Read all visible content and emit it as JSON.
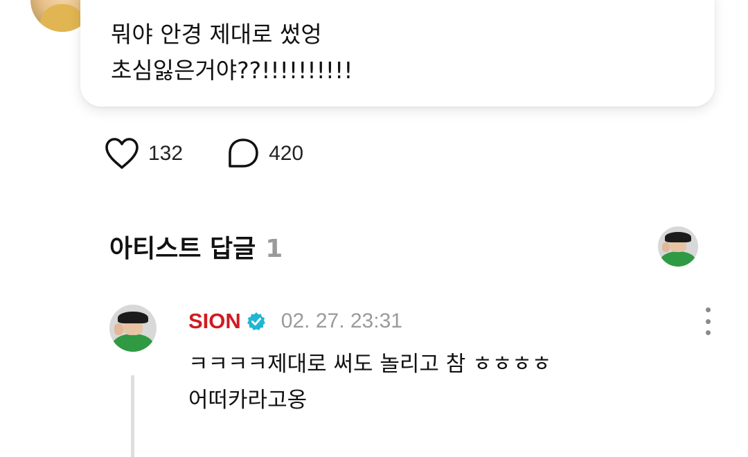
{
  "post": {
    "text": "뭐야 안경 제대로 썼엉\n초심잃은거야??!!!!!!!!!!"
  },
  "actions": {
    "like_count": "132",
    "comment_count": "420"
  },
  "section": {
    "title": "아티스트 답글",
    "count": "1"
  },
  "reply": {
    "author": "SION",
    "date": "02. 27. 23:31",
    "text": "ㅋㅋㅋㅋ제대로 써도 놀리고 참 ㅎㅎㅎㅎ\n어떠카라고옹"
  },
  "colors": {
    "author_name": "#d01b22",
    "verified_badge": "#1fb6d6",
    "meta_gray": "#9a9a9a",
    "thread_line": "#dedede"
  },
  "icons": {
    "like": "heart-icon",
    "comment": "speech-bubble-icon",
    "verified": "verified-check-icon",
    "more": "more-vertical-icon"
  }
}
